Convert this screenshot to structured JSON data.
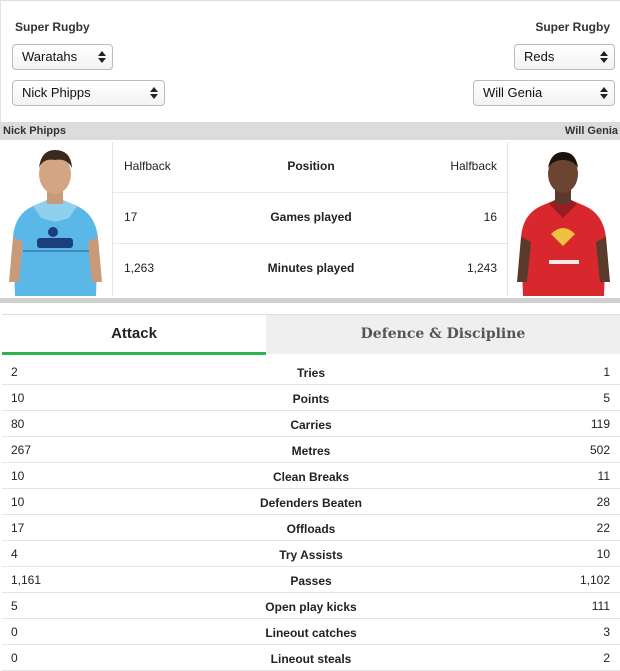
{
  "selectors": {
    "left": {
      "competition": "Super Rugby",
      "team": "Waratahs",
      "player": "Nick Phipps"
    },
    "right": {
      "competition": "Super Rugby",
      "team": "Reds",
      "player": "Will Genia"
    }
  },
  "namebar": {
    "left": "Nick Phipps",
    "right": "Will Genia"
  },
  "colors": {
    "accent": "#2fb34a",
    "waratahs_jersey": "#5ab8e8",
    "reds_jersey": "#d8282e"
  },
  "profile_rows": [
    {
      "label": "Position",
      "left": "Halfback",
      "right": "Halfback"
    },
    {
      "label": "Games played",
      "left": "17",
      "right": "16"
    },
    {
      "label": "Minutes played",
      "left": "1,263",
      "right": "1,243"
    }
  ],
  "tabs": [
    {
      "label": "Attack",
      "active": true
    },
    {
      "label": "Defence & Discipline",
      "active": false
    }
  ],
  "stats": [
    {
      "label": "Tries",
      "left": "2",
      "right": "1"
    },
    {
      "label": "Points",
      "left": "10",
      "right": "5"
    },
    {
      "label": "Carries",
      "left": "80",
      "right": "119"
    },
    {
      "label": "Metres",
      "left": "267",
      "right": "502"
    },
    {
      "label": "Clean Breaks",
      "left": "10",
      "right": "11"
    },
    {
      "label": "Defenders Beaten",
      "left": "10",
      "right": "28"
    },
    {
      "label": "Offloads",
      "left": "17",
      "right": "22"
    },
    {
      "label": "Try Assists",
      "left": "4",
      "right": "10"
    },
    {
      "label": "Passes",
      "left": "1,161",
      "right": "1,102"
    },
    {
      "label": "Open play kicks",
      "left": "5",
      "right": "111"
    },
    {
      "label": "Lineout catches",
      "left": "0",
      "right": "3"
    },
    {
      "label": "Lineout steals",
      "left": "0",
      "right": "2"
    }
  ]
}
